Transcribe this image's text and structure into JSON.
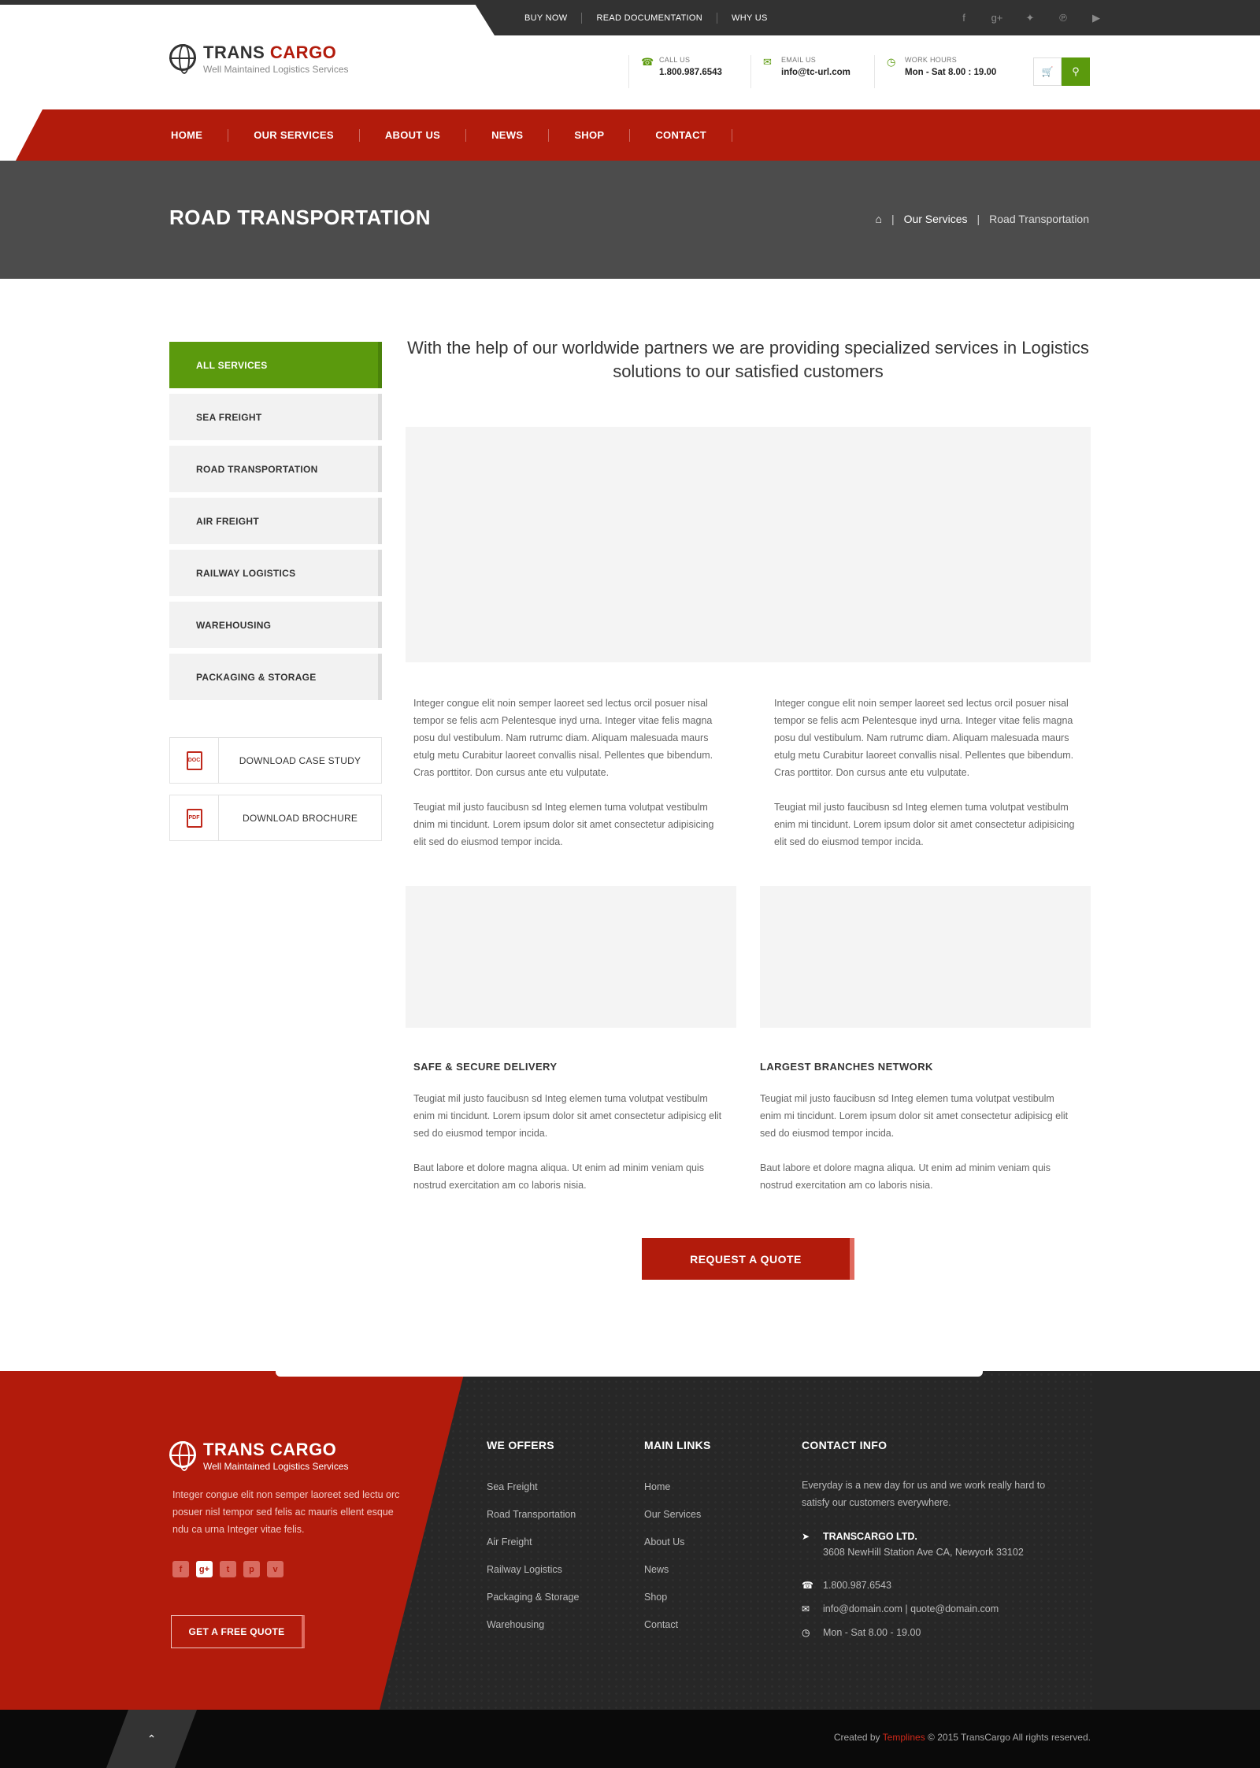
{
  "topbar": {
    "links": [
      "BUY NOW",
      "READ DOCUMENTATION",
      "WHY US"
    ],
    "social_icons": [
      "facebook-icon",
      "google-plus-icon",
      "twitter-icon",
      "pinterest-icon",
      "youtube-icon"
    ]
  },
  "brand": {
    "name_part1": "TRANS",
    "name_part2": "CARGO",
    "tagline": "Well Maintained Logistics Services",
    "accent_red": "#b21b0c",
    "accent_green": "#5b9a0d"
  },
  "header": {
    "call": {
      "label": "CALL US",
      "value": "1.800.987.6543"
    },
    "email": {
      "label": "EMAIL US",
      "value": "info@tc-url.com"
    },
    "hours": {
      "label": "WORK HOURS",
      "value": "Mon - Sat  8.00 : 19.00"
    }
  },
  "nav": [
    "HOME",
    "OUR SERVICES",
    "ABOUT US",
    "NEWS",
    "SHOP",
    "CONTACT"
  ],
  "page": {
    "title": "ROAD TRANSPORTATION",
    "breadcrumb": {
      "parent": "Our Services",
      "current": "Road Transportation"
    }
  },
  "sidebar": {
    "items": [
      "ALL SERVICES",
      "SEA FREIGHT",
      "ROAD TRANSPORTATION",
      "AIR FREIGHT",
      "RAILWAY LOGISTICS",
      "WAREHOUSING",
      "PACKAGING & STORAGE"
    ],
    "active_index": 0,
    "downloads": [
      {
        "icon_text": "DOC",
        "label": "DOWNLOAD CASE STUDY"
      },
      {
        "icon_text": "PDF",
        "label": "DOWNLOAD BROCHURE"
      }
    ]
  },
  "main": {
    "intro": "With the help of our worldwide partners we are providing specialized services in Logistics solutions to our satisfied customers",
    "col1_p1": "Integer congue elit noin semper laoreet sed lectus orcil posuer nisal tempor se felis acm Pelentesque inyd urna. Integer vitae felis magna posu dul vestibulum. Nam rutrumc diam. Aliquam malesuada maurs etulg metu Curabitur laoreet convallis nisal. Pellentes que bibendum. Cras porttitor. Don cursus ante etu  vulputate.",
    "col1_p2": "Teugiat mil justo faucibusn sd Integ elemen tuma volutpat vestibulm dnim mi tincidunt. Lorem ipsum dolor sit amet consectetur adipisicing elit sed do eiusmod tempor incida.",
    "col2_p1": "Integer congue elit noin semper laoreet sed lectus orcil posuer nisal tempor se felis acm Pelentesque inyd urna. Integer vitae felis magna posu dul vestibulum. Nam rutrumc diam. Aliquam malesuada maurs etulg metu Curabitur laoreet convallis nisal. Pellentes que bibendum. Cras porttitor. Don cursus ante etu vulputate.",
    "col2_p2": "Teugiat mil justo faucibusn sd Integ elemen tuma volutpat vestibulm enim mi tincidunt. Lorem ipsum dolor sit amet consectetur adipisicing elit sed do eiusmod tempor incida.",
    "features": [
      {
        "title": "SAFE & SECURE DELIVERY",
        "p1": "Teugiat mil justo faucibusn sd Integ elemen tuma volutpat vestibulm enim mi tincidunt. Lorem ipsum dolor sit amet consectetur adipisicg elit sed do eiusmod tempor incida.",
        "p2": "Baut labore et dolore magna aliqua. Ut enim ad minim veniam quis nostrud exercitation am co laboris nisia."
      },
      {
        "title": "LARGEST BRANCHES NETWORK",
        "p1": "Teugiat mil justo faucibusn sd Integ elemen tuma volutpat vestibulm enim mi tincidunt. Lorem ipsum dolor sit amet consectetur adipisicg elit sed do eiusmod tempor incida.",
        "p2": "Baut labore et dolore magna aliqua. Ut enim ad minim veniam quis nostrud exercitation am co laboris nisia."
      }
    ],
    "cta": "REQUEST A QUOTE"
  },
  "footer": {
    "about": "Integer congue elit non semper laoreet sed lectu orc posuer nisl tempor sed felis ac mauris ellent esque ndu ca urna Integer vitae felis.",
    "social_icons": [
      "facebook-icon",
      "google-plus-icon",
      "twitter-icon",
      "pinterest-icon",
      "vimeo-icon"
    ],
    "quote_button": "GET A FREE QUOTE",
    "offers_title": "WE OFFERS",
    "offers": [
      "Sea Freight",
      "Road Transportation",
      "Air Freight",
      "Railway Logistics",
      "Packaging & Storage",
      "Warehousing"
    ],
    "links_title": "MAIN LINKS",
    "links": [
      "Home",
      "Our Services",
      "About Us",
      "News",
      "Shop",
      "Contact"
    ],
    "contact_title": "CONTACT INFO",
    "contact_intro": "Everyday is a new day for us and we work really hard to satisfy our customers everywhere.",
    "company": "TRANSCARGO LTD.",
    "address": "3608 NewHill Station Ave CA, Newyork 33102",
    "phone": "1.800.987.6543",
    "emails": "info@domain.com  |  quote@domain.com",
    "hours": "Mon - Sat  8.00 - 19.00"
  },
  "bottom": {
    "created_by": "Created by",
    "author": "Templines",
    "rights": "© 2015 TransCargo All rights reserved."
  }
}
